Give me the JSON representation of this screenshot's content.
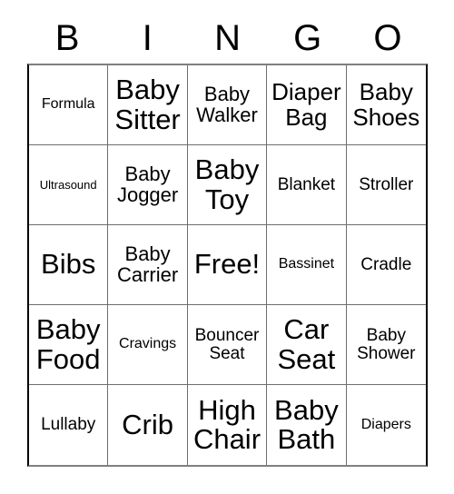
{
  "card": {
    "title": "BINGO",
    "header_letters": [
      "B",
      "I",
      "N",
      "G",
      "O"
    ],
    "free_space_label": "Free!",
    "colors": {
      "background": "#ffffff",
      "text": "#000000",
      "grid_line": "#6e6e6e",
      "grid_border": "#000000"
    },
    "columns": 5,
    "rows": 5,
    "cells": [
      {
        "label": "Formula",
        "size": "s",
        "column": "B",
        "row": 1
      },
      {
        "label": "Baby Sitter",
        "size": "xxl",
        "column": "I",
        "row": 1
      },
      {
        "label": "Baby Walker",
        "size": "l",
        "column": "N",
        "row": 1
      },
      {
        "label": "Diaper Bag",
        "size": "xl",
        "column": "G",
        "row": 1
      },
      {
        "label": "Baby Shoes",
        "size": "xl",
        "column": "O",
        "row": 1
      },
      {
        "label": "Ultrasound",
        "size": "xs",
        "column": "B",
        "row": 2
      },
      {
        "label": "Baby Jogger",
        "size": "l",
        "column": "I",
        "row": 2
      },
      {
        "label": "Baby Toy",
        "size": "xxl",
        "column": "N",
        "row": 2
      },
      {
        "label": "Blanket",
        "size": "m",
        "column": "G",
        "row": 2
      },
      {
        "label": "Stroller",
        "size": "m",
        "column": "O",
        "row": 2
      },
      {
        "label": "Bibs",
        "size": "xxl",
        "column": "B",
        "row": 3
      },
      {
        "label": "Baby Carrier",
        "size": "l",
        "column": "I",
        "row": 3
      },
      {
        "label": "Free!",
        "size": "xxl",
        "column": "N",
        "row": 3
      },
      {
        "label": "Bassinet",
        "size": "s",
        "column": "G",
        "row": 3
      },
      {
        "label": "Cradle",
        "size": "m",
        "column": "O",
        "row": 3
      },
      {
        "label": "Baby Food",
        "size": "xxl",
        "column": "B",
        "row": 4
      },
      {
        "label": "Cravings",
        "size": "s",
        "column": "I",
        "row": 4
      },
      {
        "label": "Bouncer Seat",
        "size": "m",
        "column": "N",
        "row": 4
      },
      {
        "label": "Car Seat",
        "size": "xxl",
        "column": "G",
        "row": 4
      },
      {
        "label": "Baby Shower",
        "size": "m",
        "column": "O",
        "row": 4
      },
      {
        "label": "Lullaby",
        "size": "m",
        "column": "B",
        "row": 5
      },
      {
        "label": "Crib",
        "size": "xxl",
        "column": "I",
        "row": 5
      },
      {
        "label": "High Chair",
        "size": "xxl",
        "column": "N",
        "row": 5
      },
      {
        "label": "Baby Bath",
        "size": "xxl",
        "column": "G",
        "row": 5
      },
      {
        "label": "Diapers",
        "size": "s",
        "column": "O",
        "row": 5
      }
    ]
  }
}
